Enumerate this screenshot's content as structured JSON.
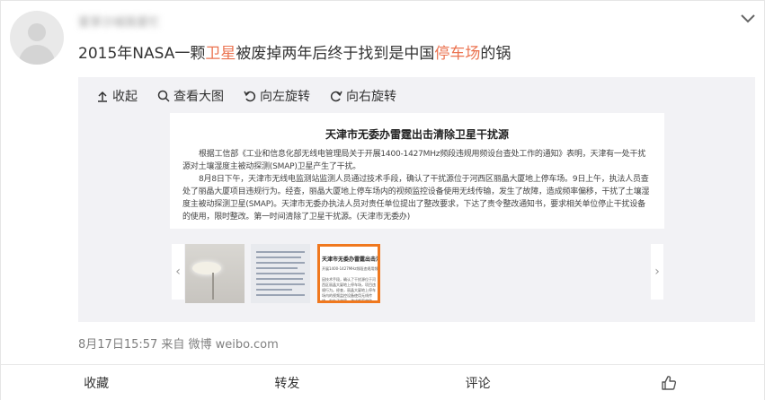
{
  "user": {
    "name": "爱享沙城我爱忙"
  },
  "post": {
    "text_parts": [
      {
        "text": "2015年NASA一颗",
        "highlight": false
      },
      {
        "text": "卫星",
        "highlight": true
      },
      {
        "text": "被废掉两年后终于找到是中国",
        "highlight": false
      },
      {
        "text": "停车场",
        "highlight": true
      },
      {
        "text": "的锅",
        "highlight": false
      }
    ]
  },
  "toolbar": {
    "collapse": "收起",
    "view_large": "查看大图",
    "rotate_left": "向左旋转",
    "rotate_right": "向右旋转"
  },
  "document": {
    "title": "天津市无委办雷霆出击清除卫星干扰源",
    "paragraphs": [
      "根据工信部《工业和信息化部无线电管理局关于开展1400-1427MHz频段违规用频设台查处工作的通知》表明，天津有一处干扰源对土壤湿度主被动探测(SMAP)卫星产生了干扰。",
      "8月8日下午，天津市无线电监测站监测人员通过技术手段，确认了干扰源位于河西区丽晶大厦地上停车场。9日上午，执法人员查处了丽晶大厦项目违规行为。经查，丽晶大厦地上停车场内的视频监控设备使用无线传输，发生了故障，造成频率偏移，干扰了土壤湿度主被动探测卫星(SMAP)。天津市无委办执法人员对责任单位提出了整改要求，下达了责令整改通知书，要求相关单位停止干扰设备的使用，限时整改。第一时间清除了卫星干扰源。(天津市无委办)"
    ]
  },
  "thumbnails": {
    "selected_index": 2,
    "third": {
      "title": "天津市无委办雷霆出击清除卫星干扰源",
      "sub": "开展1400-1427MHz频段违规用频",
      "body": "因技术手段，确认了干扰源位于河西区丽晶大厦地上停车场，项目违规行为。经查，丽晶大厦地上停车场内的视频监控设备使用无线传输，发生了故障，造成频率偏移，干扰了土壤湿度主被动探测卫星(SMAP)。(天津市无委办)"
    }
  },
  "meta": {
    "timestamp": "8月17日15:57 来自 微博 weibo.com"
  },
  "actions": {
    "favorite": "收藏",
    "repost": "转发",
    "comment": "评论",
    "like_icon": "thumbs-up-icon"
  },
  "colors": {
    "highlight": "#eb7350",
    "selected_border": "#f0781e",
    "media_bg": "#f2f2f5"
  }
}
